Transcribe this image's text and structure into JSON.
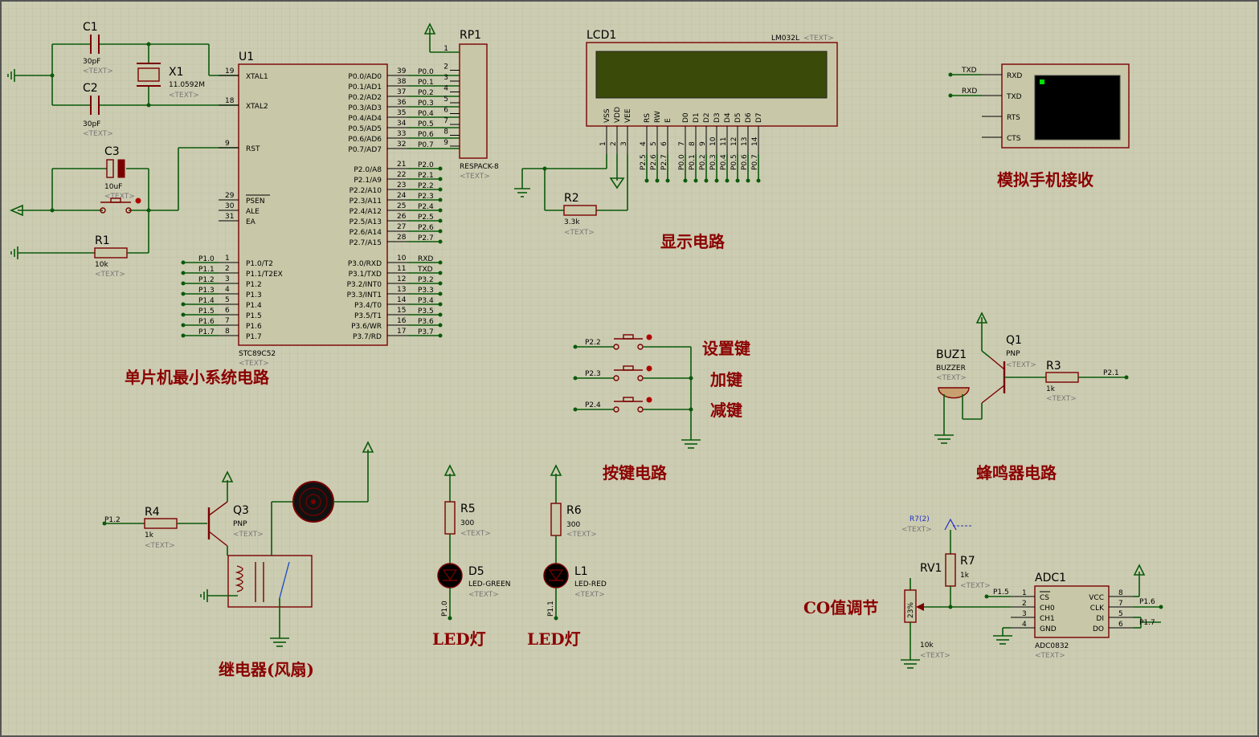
{
  "captions": {
    "mcu": "单片机最小系统电路",
    "display": "显示电路",
    "phone": "模拟手机接收",
    "keys": "按键电路",
    "buzzer": "蜂鸣器电路",
    "relay": "继电器(风扇)",
    "led1": "LED灯",
    "led2": "LED灯",
    "co": "CO值调节",
    "key_set": "设置键",
    "key_add": "加键",
    "key_sub": "减键"
  },
  "parts": {
    "c1": {
      "ref": "C1",
      "val": "30pF",
      "tx": "<TEXT>"
    },
    "c2": {
      "ref": "C2",
      "val": "30pF",
      "tx": "<TEXT>"
    },
    "c3": {
      "ref": "C3",
      "val": "10uF",
      "tx": "<TEXT>"
    },
    "x1": {
      "ref": "X1",
      "val": "11.0592M",
      "tx": "<TEXT>"
    },
    "r1": {
      "ref": "R1",
      "val": "10k",
      "tx": "<TEXT>"
    },
    "u1": {
      "ref": "U1",
      "val": "STC89C52",
      "tx": "<TEXT>"
    },
    "rp1": {
      "ref": "RP1",
      "val": "RESPACK-8",
      "tx": "<TEXT>"
    },
    "lcd1": {
      "ref": "LCD1",
      "val": "LM032L",
      "tx": "<TEXT>"
    },
    "r2": {
      "ref": "R2",
      "val": "3.3k",
      "tx": "<TEXT>"
    },
    "buz1": {
      "ref": "BUZ1",
      "val": "BUZZER",
      "tx": "<TEXT>"
    },
    "q1": {
      "ref": "Q1",
      "val": "PNP",
      "tx": "<TEXT>"
    },
    "r3": {
      "ref": "R3",
      "val": "1k",
      "tx": "<TEXT>"
    },
    "q3": {
      "ref": "Q3",
      "val": "PNP",
      "tx": "<TEXT>"
    },
    "r4": {
      "ref": "R4",
      "val": "1k",
      "tx": "<TEXT>"
    },
    "r5": {
      "ref": "R5",
      "val": "300",
      "tx": "<TEXT>"
    },
    "d5": {
      "ref": "D5",
      "val": "LED-GREEN",
      "tx": "<TEXT>"
    },
    "r6": {
      "ref": "R6",
      "val": "300",
      "tx": "<TEXT>"
    },
    "l1": {
      "ref": "L1",
      "val": "LED-RED",
      "tx": "<TEXT>"
    },
    "r7": {
      "ref": "R7",
      "val": "1k",
      "tx": "<TEXT>"
    },
    "r7b": {
      "ref": "R7(2)",
      "tx": "<TEXT>"
    },
    "rv1": {
      "ref": "RV1",
      "val": "10k",
      "tx": "<TEXT>"
    },
    "adc1": {
      "ref": "ADC1",
      "val": "ADC0832",
      "tx": "<TEXT>"
    }
  },
  "u1_left": [
    {
      "num": "19",
      "name": "XTAL1"
    },
    {
      "num": "18",
      "name": "XTAL2"
    },
    {
      "num": "9",
      "name": "RST"
    },
    {
      "num": "29",
      "name": "PSEN"
    },
    {
      "num": "30",
      "name": "ALE"
    },
    {
      "num": "31",
      "name": "EA"
    }
  ],
  "u1_p1": [
    {
      "num": "1",
      "name": "P1.0/T2",
      "net": "P1.0"
    },
    {
      "num": "2",
      "name": "P1.1/T2EX",
      "net": "P1.1"
    },
    {
      "num": "3",
      "name": "P1.2",
      "net": "P1.2"
    },
    {
      "num": "4",
      "name": "P1.3",
      "net": "P1.3"
    },
    {
      "num": "5",
      "name": "P1.4",
      "net": "P1.4"
    },
    {
      "num": "6",
      "name": "P1.5",
      "net": "P1.5"
    },
    {
      "num": "7",
      "name": "P1.6",
      "net": "P1.6"
    },
    {
      "num": "8",
      "name": "P1.7",
      "net": "P1.7"
    }
  ],
  "u1_p0": [
    {
      "num": "39",
      "name": "P0.0/AD0",
      "net": "P0.0"
    },
    {
      "num": "38",
      "name": "P0.1/AD1",
      "net": "P0.1"
    },
    {
      "num": "37",
      "name": "P0.2/AD2",
      "net": "P0.2"
    },
    {
      "num": "36",
      "name": "P0.3/AD3",
      "net": "P0.3"
    },
    {
      "num": "35",
      "name": "P0.4/AD4",
      "net": "P0.4"
    },
    {
      "num": "34",
      "name": "P0.5/AD5",
      "net": "P0.5"
    },
    {
      "num": "33",
      "name": "P0.6/AD6",
      "net": "P0.6"
    },
    {
      "num": "32",
      "name": "P0.7/AD7",
      "net": "P0.7"
    }
  ],
  "u1_p2": [
    {
      "num": "21",
      "name": "P2.0/A8",
      "net": "P2.0"
    },
    {
      "num": "22",
      "name": "P2.1/A9",
      "net": "P2.1"
    },
    {
      "num": "23",
      "name": "P2.2/A10",
      "net": "P2.2"
    },
    {
      "num": "24",
      "name": "P2.3/A11",
      "net": "P2.3"
    },
    {
      "num": "25",
      "name": "P2.4/A12",
      "net": "P2.4"
    },
    {
      "num": "26",
      "name": "P2.5/A13",
      "net": "P2.5"
    },
    {
      "num": "27",
      "name": "P2.6/A14",
      "net": "P2.6"
    },
    {
      "num": "28",
      "name": "P2.7/A15",
      "net": "P2.7"
    }
  ],
  "u1_p3": [
    {
      "num": "10",
      "name": "P3.0/RXD",
      "net": "RXD"
    },
    {
      "num": "11",
      "name": "P3.1/TXD",
      "net": "TXD"
    },
    {
      "num": "12",
      "name": "P3.2/INT0",
      "net": "P3.2"
    },
    {
      "num": "13",
      "name": "P3.3/INT1",
      "net": "P3.3"
    },
    {
      "num": "14",
      "name": "P3.4/T0",
      "net": "P3.4"
    },
    {
      "num": "15",
      "name": "P3.5/T1",
      "net": "P3.5"
    },
    {
      "num": "16",
      "name": "P3.6/WR",
      "net": "P3.6"
    },
    {
      "num": "17",
      "name": "P3.7/RD",
      "net": "P3.7"
    }
  ],
  "lcd_pins": [
    {
      "name": "VSS",
      "num": "1",
      "net": ""
    },
    {
      "name": "VDD",
      "num": "2",
      "net": ""
    },
    {
      "name": "VEE",
      "num": "3",
      "net": ""
    },
    {
      "name": "RS",
      "num": "4",
      "net": "P2.5"
    },
    {
      "name": "RW",
      "num": "5",
      "net": "P2.6"
    },
    {
      "name": "E",
      "num": "6",
      "net": "P2.7"
    },
    {
      "name": "D0",
      "num": "7",
      "net": "P0.0"
    },
    {
      "name": "D1",
      "num": "8",
      "net": "P0.1"
    },
    {
      "name": "D2",
      "num": "9",
      "net": "P0.2"
    },
    {
      "name": "D3",
      "num": "10",
      "net": "P0.3"
    },
    {
      "name": "D4",
      "num": "11",
      "net": "P0.4"
    },
    {
      "name": "D5",
      "num": "12",
      "net": "P0.5"
    },
    {
      "name": "D6",
      "num": "13",
      "net": "P0.6"
    },
    {
      "name": "D7",
      "num": "14",
      "net": "P0.7"
    }
  ],
  "rp1_pins": [
    "1",
    "2",
    "3",
    "4",
    "5",
    "6",
    "7",
    "8",
    "9"
  ],
  "terminal": {
    "pins": [
      "RXD",
      "TXD",
      "RTS",
      "CTS"
    ],
    "nets": [
      "TXD",
      "RXD"
    ]
  },
  "keys": [
    {
      "net": "P2.2"
    },
    {
      "net": "P2.3"
    },
    {
      "net": "P2.4"
    }
  ],
  "buzzer_net": "P2.1",
  "relay_net": "P1.2",
  "led_nets": {
    "d5": "P1.0",
    "l1": "P1.1"
  },
  "adc": {
    "left": [
      {
        "num": "1",
        "name": "CS",
        "net": "P1.5"
      },
      {
        "num": "2",
        "name": "CH0",
        "net": ""
      },
      {
        "num": "3",
        "name": "CH1",
        "net": ""
      },
      {
        "num": "4",
        "name": "GND",
        "net": ""
      }
    ],
    "right": [
      {
        "num": "8",
        "name": "VCC",
        "net": ""
      },
      {
        "num": "7",
        "name": "CLK",
        "net": "P1.6"
      },
      {
        "num": "5",
        "name": "DI",
        "net": ""
      },
      {
        "num": "6",
        "name": "DO",
        "net": "P1.7"
      }
    ]
  },
  "rv1_body": "23%",
  "colors": {
    "wire": "#0a5a0a",
    "part": "#7a0000",
    "caption": "#8b0000",
    "lcd_screen": "#3a4a08",
    "led_on": "#000000"
  }
}
